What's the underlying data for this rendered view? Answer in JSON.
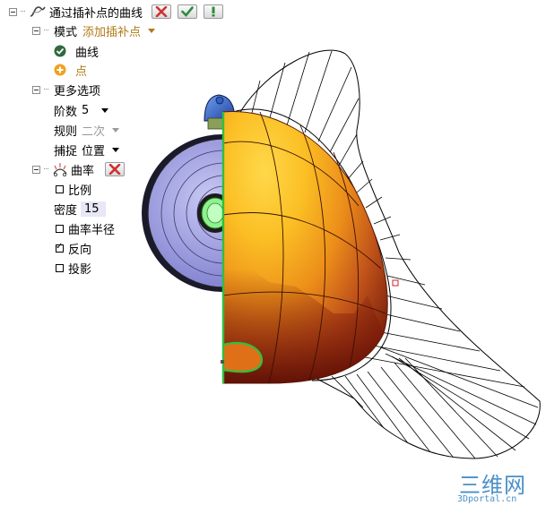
{
  "panel": {
    "title": "通过插补点的曲线",
    "mode_label": "模式",
    "mode_value": "添加插补点",
    "child_curve": "曲线",
    "child_point": "点",
    "more_options": "更多选项",
    "degree_label": "阶数",
    "degree_value": "5",
    "rule_label": "规则",
    "rule_value": "二次",
    "snap_label": "捕捉",
    "snap_value": "位置",
    "curvature_label": "曲率",
    "scale_label": "比例",
    "density_label": "密度",
    "density_value": "15",
    "radius_label": "曲率半径",
    "reverse_label": "反向",
    "project_label": "投影"
  },
  "checkboxes": {
    "scale": false,
    "radius": false,
    "reverse": true,
    "project": false
  },
  "colors": {
    "accent": "#b07a16",
    "cancel": "#d03030",
    "ok": "#2e8b3e",
    "model_orange": "#f0a020",
    "disc_blue": "#8f8fdc",
    "edge_green": "#2fbf3f"
  },
  "watermark": {
    "big": "三维网",
    "small": "3Dportal.cn"
  }
}
